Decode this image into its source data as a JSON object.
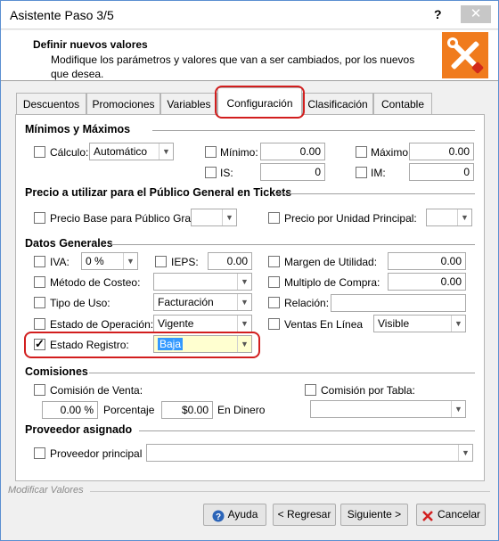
{
  "window": {
    "title": "Asistente Paso 3/5",
    "help": "?",
    "close": "✕"
  },
  "header": {
    "title": "Definir nuevos valores",
    "description": "Modifique los parámetros y valores que van a ser cambiados, por los nuevos que desea."
  },
  "tabs": [
    "Descuentos",
    "Promociones",
    "Variables",
    "Configuración",
    "Clasificación",
    "Contable"
  ],
  "minimos": {
    "title": "Mínimos y Máximos",
    "calculo_label": "Cálculo:",
    "calculo_value": "Automático",
    "minimo_label": "Mínimo:",
    "minimo_value": "0.00",
    "maximo_label": "Máximo:",
    "maximo_value": "0.00",
    "is_label": "IS:",
    "is_value": "0",
    "im_label": "IM:",
    "im_value": "0"
  },
  "precio": {
    "title": "Precio a utilizar para el Público General en Tickets",
    "base_label": "Precio Base para Público Gral:",
    "unidad_label": "Precio por Unidad Principal:"
  },
  "datos": {
    "title": "Datos Generales",
    "iva_label": "IVA:",
    "iva_value": "0 %",
    "ieps_label": "IEPS:",
    "ieps_value": "0.00",
    "margen_label": "Margen de Utilidad:",
    "margen_value": "0.00",
    "metodo_label": "Método de Costeo:",
    "multiplo_label": "Multiplo de Compra:",
    "multiplo_value": "0.00",
    "tipo_label": "Tipo de Uso:",
    "tipo_value": "Facturación",
    "relacion_label": "Relación:",
    "operacion_label": "Estado de Operación:",
    "operacion_value": "Vigente",
    "ventas_label": "Ventas En Línea",
    "ventas_value": "Visible",
    "registro_label": "Estado Registro:",
    "registro_value": "Baja"
  },
  "comisiones": {
    "title": "Comisiones",
    "venta_label": "Comisión de Venta:",
    "tabla_label": "Comisión por Tabla:",
    "porcentaje_value": "0.00 %",
    "porcentaje_label": "Porcentaje",
    "dinero_value": "$0.00",
    "dinero_label": "En Dinero"
  },
  "proveedor": {
    "title": "Proveedor asignado",
    "principal_label": "Proveedor principal"
  },
  "footer": {
    "label": "Modificar Valores",
    "ayuda": "Ayuda",
    "regresar": "< Regresar",
    "siguiente": "Siguiente >",
    "cancelar": "Cancelar"
  },
  "colors": {
    "highlight": "#d21e1e",
    "accent": "#3399ff",
    "logo": "#f07b1d"
  }
}
